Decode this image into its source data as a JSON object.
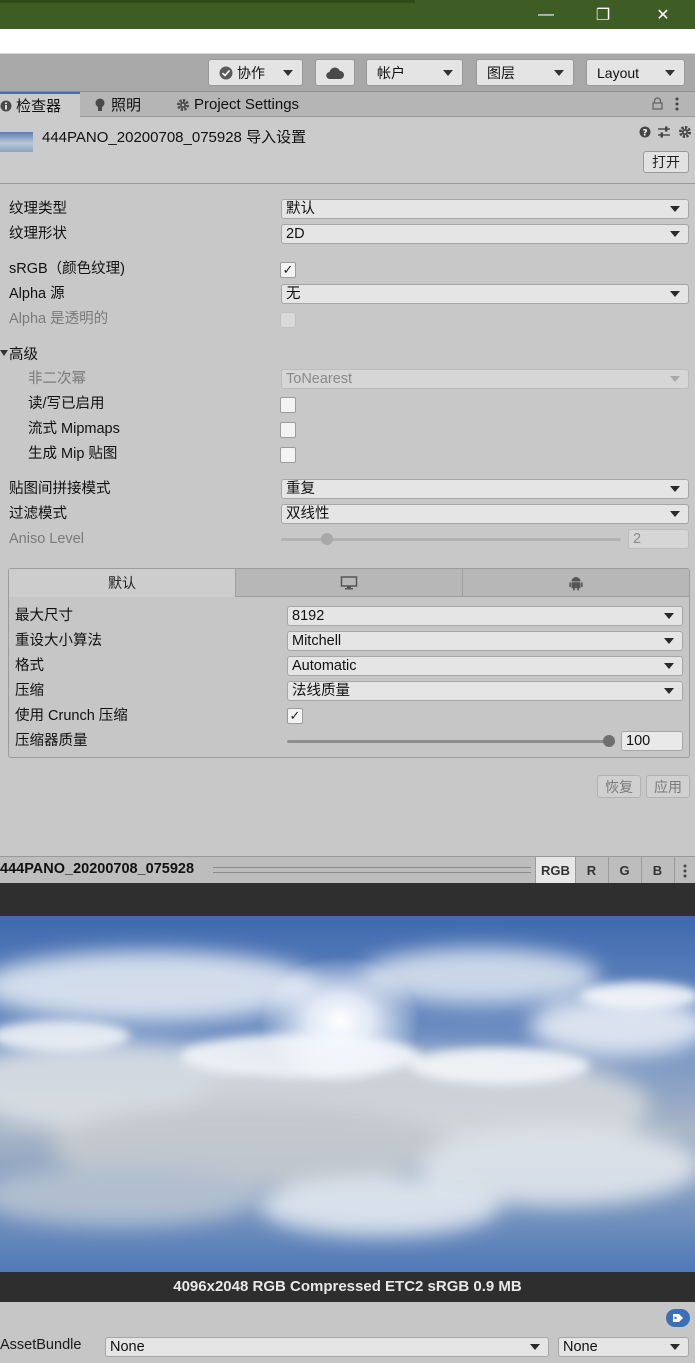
{
  "window": {
    "minimize_glyph": "—",
    "restore_glyph": "❐",
    "close_glyph": "✕"
  },
  "toolbar": {
    "collab_label": "协作",
    "account_label": "帐户",
    "layers_label": "图层",
    "layout_label": "Layout"
  },
  "tabs": [
    {
      "label": "检查器",
      "icon": "info-icon"
    },
    {
      "label": "照明",
      "icon": "bulb-icon"
    },
    {
      "label": "Project Settings",
      "icon": "gear-icon"
    }
  ],
  "header": {
    "title": "444PANO_20200708_075928 导入设置",
    "open_label": "打开"
  },
  "props": {
    "texture_type_label": "纹理类型",
    "texture_type_value": "默认",
    "texture_shape_label": "纹理形状",
    "texture_shape_value": "2D",
    "srgb_label": "sRGB（颜色纹理)",
    "alpha_source_label": "Alpha 源",
    "alpha_source_value": "无",
    "alpha_transparent_label": "Alpha 是透明的",
    "advanced_label": "高级",
    "npot_label": "非二次幂",
    "npot_value": "ToNearest",
    "rw_label": "读/写已启用",
    "streaming_label": "流式 Mipmaps",
    "genmip_label": "生成 Mip 贴图",
    "wrap_label": "贴图间拼接模式",
    "wrap_value": "重复",
    "filter_label": "过滤模式",
    "filter_value": "双线性",
    "aniso_label": "Aniso Level",
    "aniso_value": "2"
  },
  "platform": {
    "default_tab_label": "默认",
    "max_size_label": "最大尺寸",
    "max_size_value": "8192",
    "resize_label": "重设大小算法",
    "resize_value": "Mitchell",
    "format_label": "格式",
    "format_value": "Automatic",
    "compression_label": "压缩",
    "compression_value": "法线质量",
    "crunch_label": "使用 Crunch 压缩",
    "quality_label": "压缩器质量",
    "quality_value": "100"
  },
  "actions": {
    "revert_label": "恢复",
    "apply_label": "应用"
  },
  "preview": {
    "title": "444PANO_20200708_075928",
    "channels": [
      "RGB",
      "R",
      "G",
      "B"
    ],
    "info": "4096x2048  RGB Compressed ETC2 sRGB   0.9 MB"
  },
  "assetbundle": {
    "label": "AssetBundle",
    "name_value": "None",
    "variant_value": "None"
  }
}
